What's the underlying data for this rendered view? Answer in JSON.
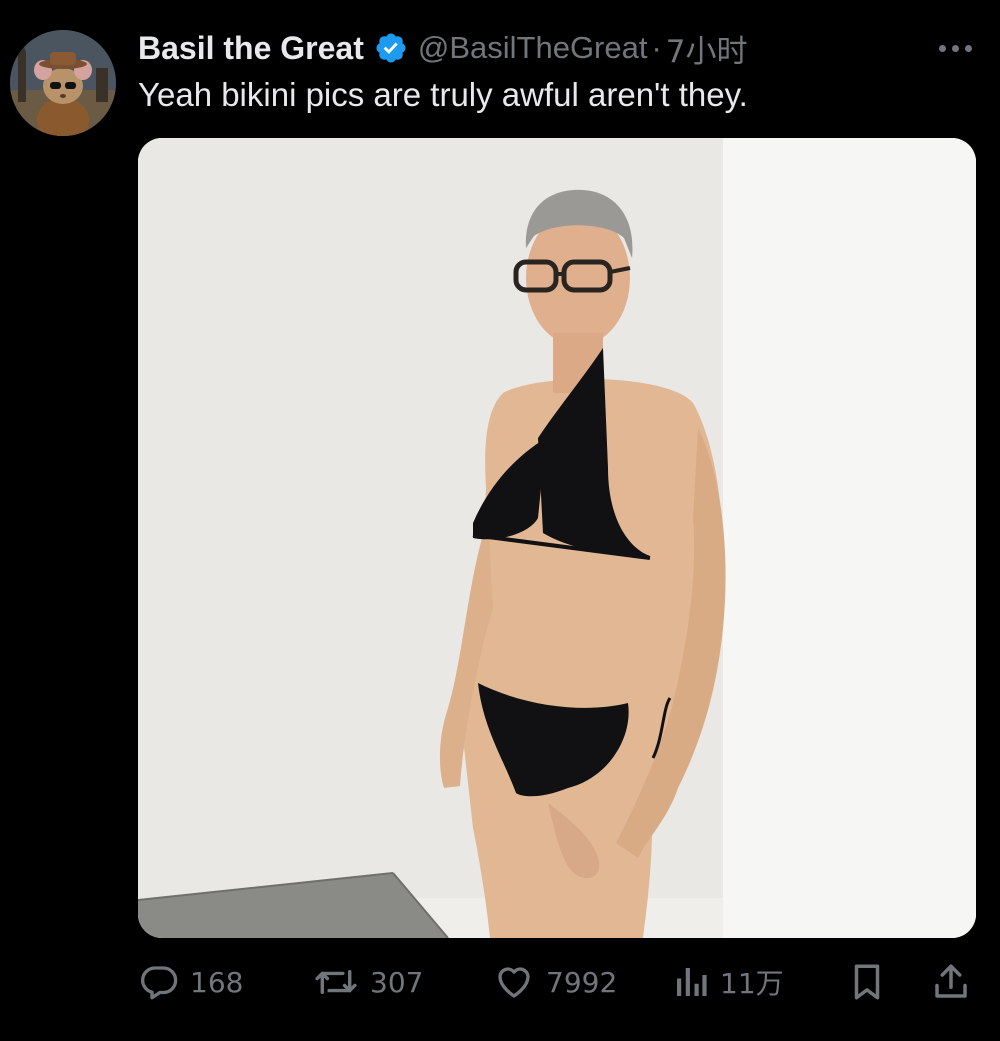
{
  "tweet": {
    "author": {
      "display_name": "Basil the Great",
      "handle": "@BasilTheGreat",
      "verified_icon": "verified-badge-icon",
      "avatar_icon": "avatar-mouse-detective"
    },
    "separator": "·",
    "timestamp": "7小时",
    "text": "Yeah bikini pics are truly awful aren't they.",
    "media": {
      "kind": "photo"
    },
    "actions": {
      "reply_count": "168",
      "retweet_count": "307",
      "like_count": "7992",
      "views_count": "11万"
    }
  },
  "colors": {
    "background": "#000000",
    "primary_text": "#e7e9ea",
    "secondary_text": "#71767b",
    "verified_blue": "#1d9bf0"
  },
  "icons": [
    "more-icon",
    "reply-icon",
    "retweet-icon",
    "like-icon",
    "views-icon",
    "bookmark-icon",
    "share-icon"
  ]
}
